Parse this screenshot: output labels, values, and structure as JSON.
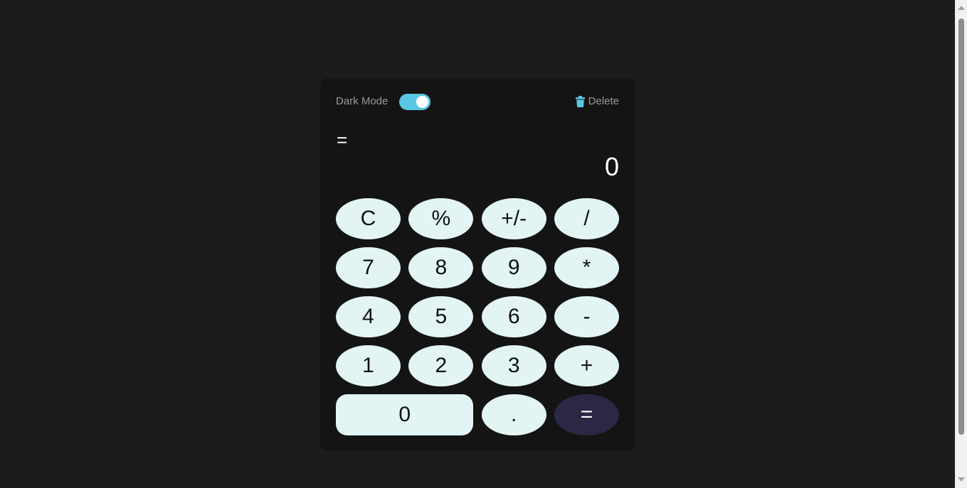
{
  "header": {
    "mode_label": "Dark Mode",
    "dark_mode_on": true,
    "delete_label": "Delete",
    "delete_icon": "trash-icon"
  },
  "display": {
    "expression": "=",
    "result": "0"
  },
  "keys": [
    {
      "label": "C",
      "name": "clear-button"
    },
    {
      "label": "%",
      "name": "percent-button"
    },
    {
      "label": "+/-",
      "name": "negate-button"
    },
    {
      "label": "/",
      "name": "divide-button"
    },
    {
      "label": "7",
      "name": "digit-7-button"
    },
    {
      "label": "8",
      "name": "digit-8-button"
    },
    {
      "label": "9",
      "name": "digit-9-button"
    },
    {
      "label": "*",
      "name": "multiply-button"
    },
    {
      "label": "4",
      "name": "digit-4-button"
    },
    {
      "label": "5",
      "name": "digit-5-button"
    },
    {
      "label": "6",
      "name": "digit-6-button"
    },
    {
      "label": "-",
      "name": "subtract-button"
    },
    {
      "label": "1",
      "name": "digit-1-button"
    },
    {
      "label": "2",
      "name": "digit-2-button"
    },
    {
      "label": "3",
      "name": "digit-3-button"
    },
    {
      "label": "+",
      "name": "add-button"
    },
    {
      "label": "0",
      "name": "digit-0-button"
    },
    {
      "label": ".",
      "name": "decimal-button"
    },
    {
      "label": "=",
      "name": "equals-button"
    }
  ],
  "colors": {
    "page_background": "#1c1c1c",
    "calculator_background": "#141414",
    "key_background": "#e2f5f4",
    "equals_background": "#2a2845",
    "toggle_accent": "#5bc6e3"
  }
}
